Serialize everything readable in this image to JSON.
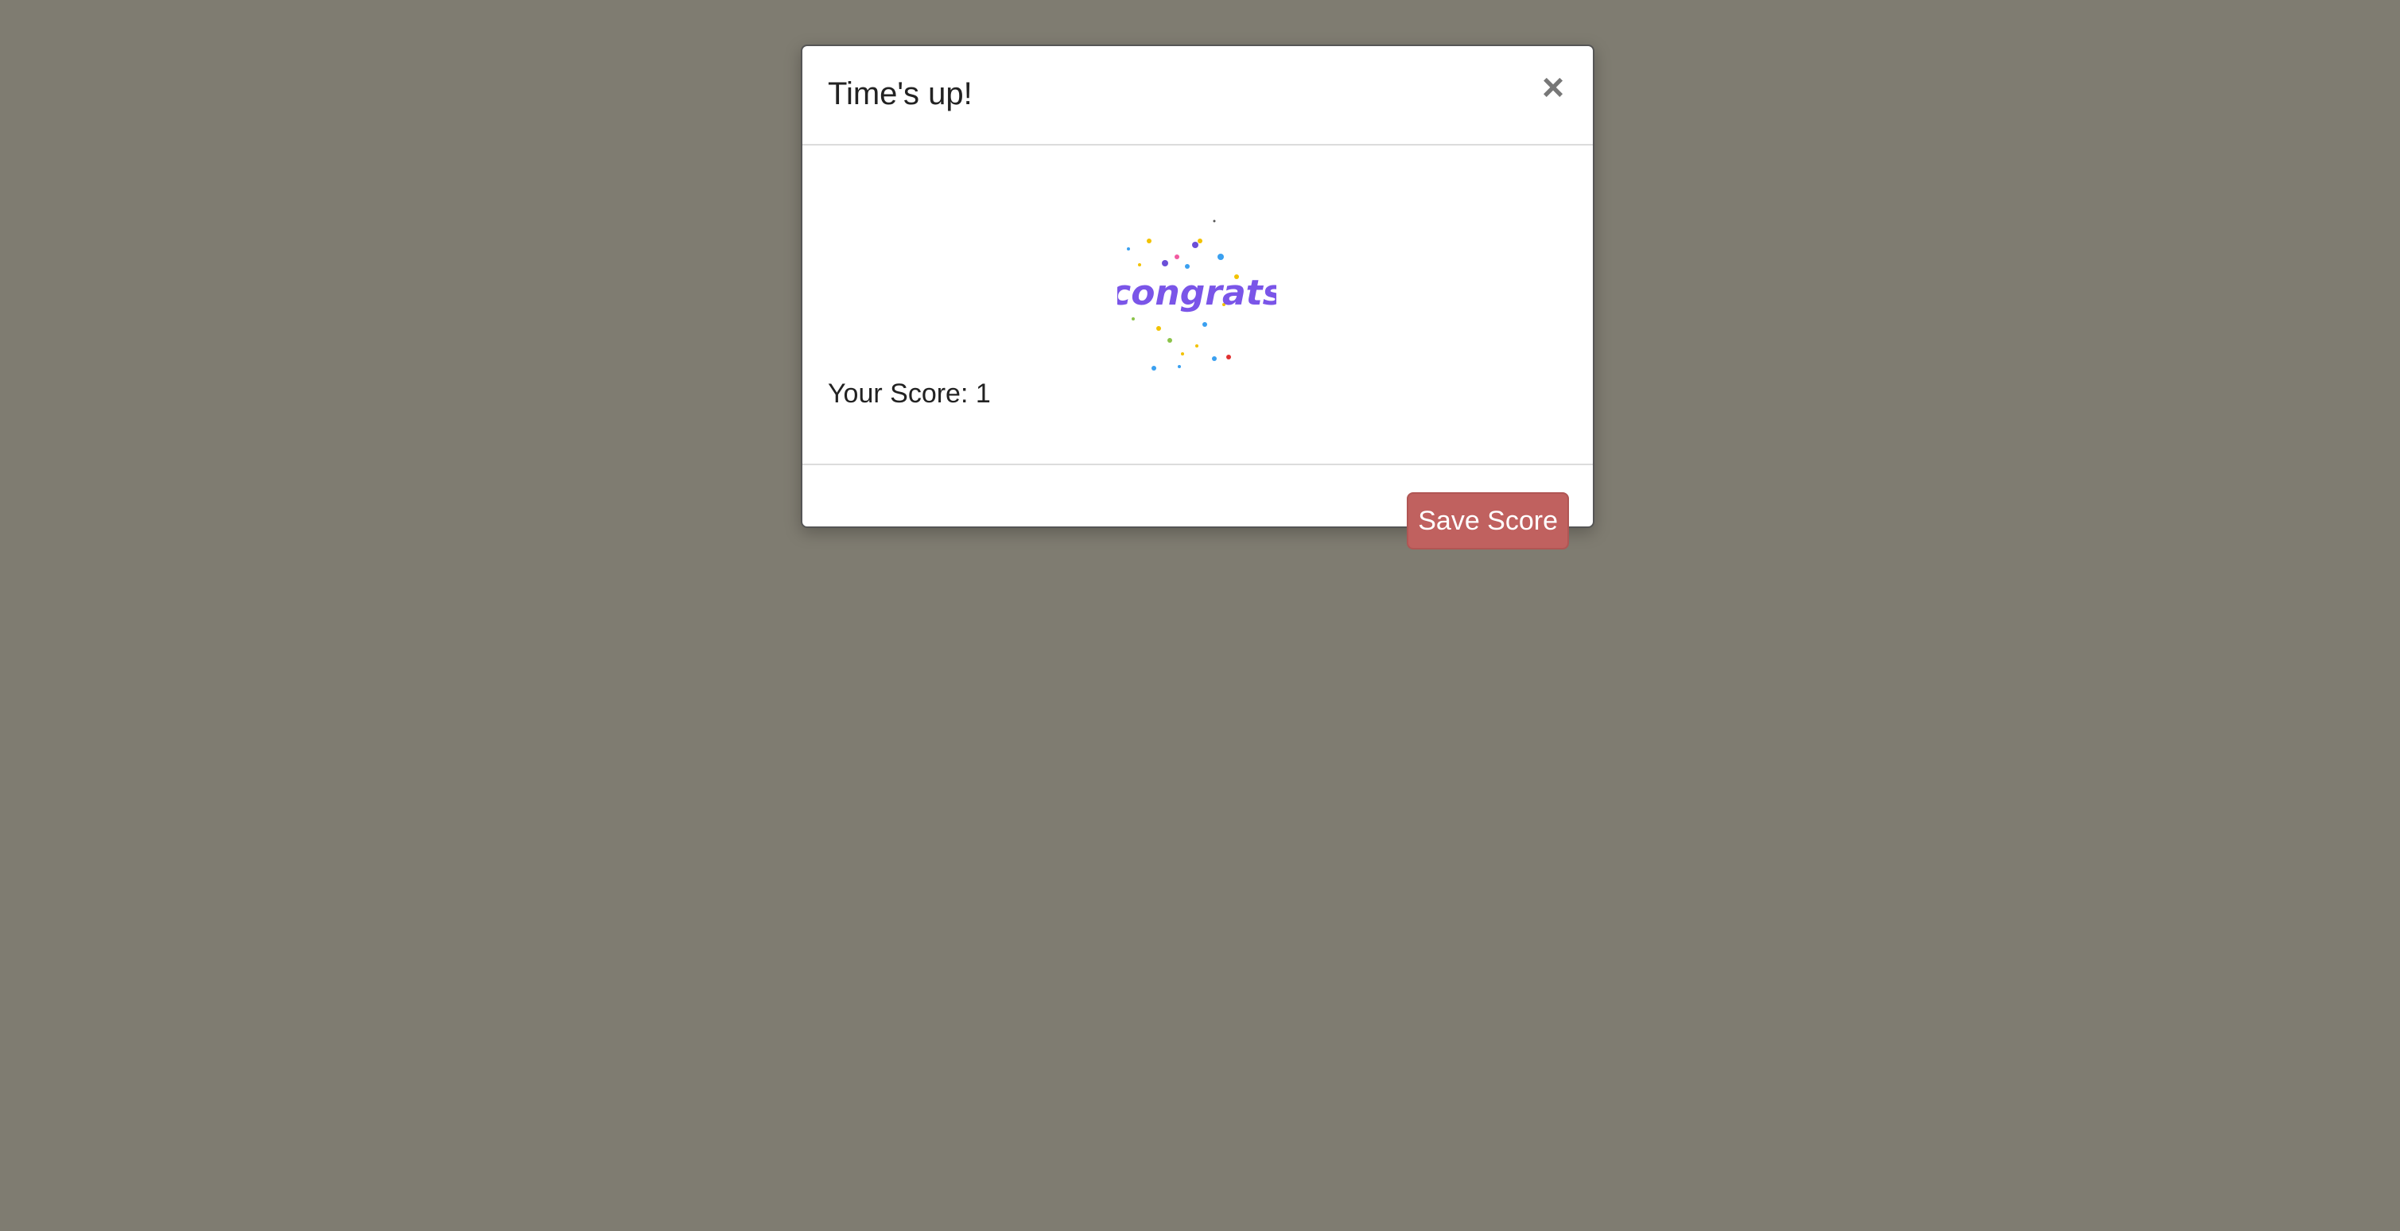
{
  "background_color": "#7f7c71",
  "modal": {
    "title": "Time's up!",
    "close_symbol": "×",
    "close_icon": "close-icon",
    "image": {
      "icon": "congrats-confetti-image",
      "text": "congrats"
    },
    "score_label": "Your Score: ",
    "score_value": "1",
    "save_button_label": "Save Score",
    "accent_color": "#c0615f"
  }
}
